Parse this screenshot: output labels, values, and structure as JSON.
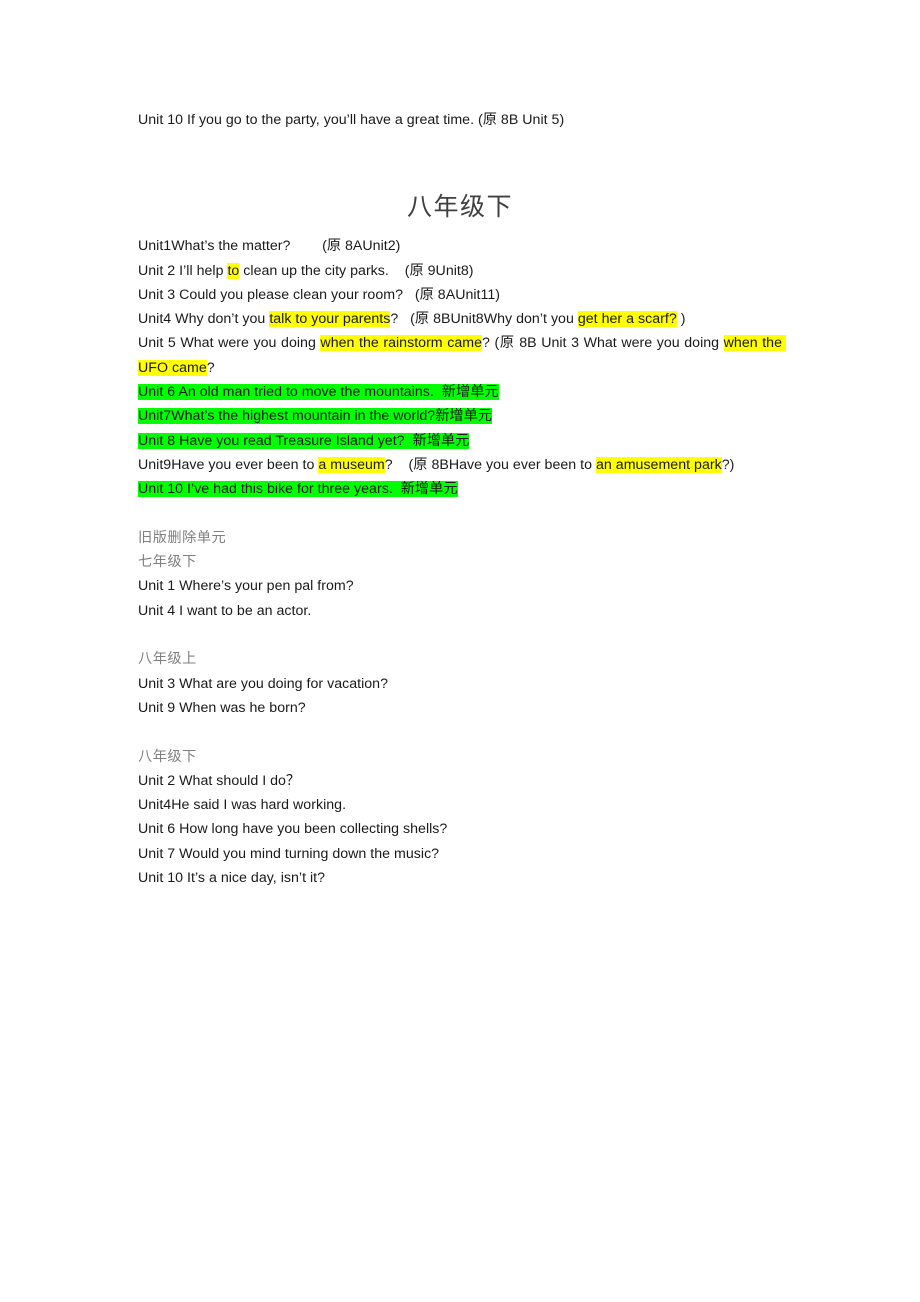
{
  "document": {
    "top_line": {
      "text": "Unit 10 If you go to the party, you’ll have a great time. (",
      "cn": "原",
      "tail": " 8B Unit 5)"
    },
    "title": "八年级下",
    "units": {
      "unit1": {
        "pre": "Unit1What’s the matter?",
        "spacer": "        (",
        "cn": "原",
        "tail": " 8AUnit2)"
      },
      "unit2": {
        "pre": "Unit 2 I’ll help ",
        "hl": "to",
        "mid": " clean up the city parks.    (",
        "cn": "原",
        "tail": " 9Unit8)"
      },
      "unit3": {
        "pre": "Unit 3 Could you please clean your room?   (",
        "cn": "原",
        "tail": " 8AUnit11)"
      },
      "unit4": {
        "pre": "Unit4 Why don’t you ",
        "hl1": "talk to your parents",
        "mid": "?   (",
        "cn": "原",
        "mid2": " 8BUnit8Why don’t you ",
        "hl2": "get her a scarf?",
        "tail": " )"
      },
      "unit5": {
        "pre": "Unit 5 What were you doing ",
        "hl1": "when the rainstorm came",
        "mid": "? (",
        "cn": "原",
        "mid2": " 8B Unit 3 What were you doing ",
        "hl2": "when the UFO came",
        "tail": "?"
      },
      "unit6": {
        "hl_en": "Unit 6 An old man tried to move the mountains.  ",
        "hl_cn": "新增单元"
      },
      "unit7": {
        "hl_en": "Unit7What’s the highest mountain in the world?",
        "hl_cn": "新增单元"
      },
      "unit8": {
        "hl_en": "Unit 8 Have you read Treasure Island yet?  ",
        "hl_cn": "新增单元"
      },
      "unit9": {
        "pre": "Unit9Have you ever been to ",
        "hl1": "a museum",
        "mid": "?    (",
        "cn": "原",
        "mid2": " 8BHave you ever been to ",
        "hl2": "an amusement park",
        "tail": "?)"
      },
      "unit10": {
        "hl_en": "Unit 10 I’ve had this bike for three years.  ",
        "hl_cn": "新增单元"
      }
    },
    "removed": {
      "heading": "旧版删除单元",
      "groups": [
        {
          "grade": "七年级下",
          "items": [
            "Unit 1 Where’s your pen pal from?",
            "Unit 4 I want to be an actor."
          ]
        },
        {
          "grade": "八年级上",
          "items": [
            "Unit 3 What are you doing for vacation?",
            "Unit 9 When was he born?"
          ]
        },
        {
          "grade": "八年级下",
          "items": [
            "Unit 2 What should I do？",
            "Unit4He said I was hard working.",
            "Unit 6 How long have you been collecting shells?",
            "Unit 7 Would you mind turning down the music?",
            "Unit 10 It’s a nice day, isn’t it?"
          ]
        }
      ]
    },
    "colors": {
      "highlight_yellow": "#ffff00",
      "highlight_green": "#00ff00",
      "body_text": "#1a1a1a",
      "heading_gray": "#808080",
      "title_gray": "#404040",
      "page_background": "#ffffff"
    }
  }
}
